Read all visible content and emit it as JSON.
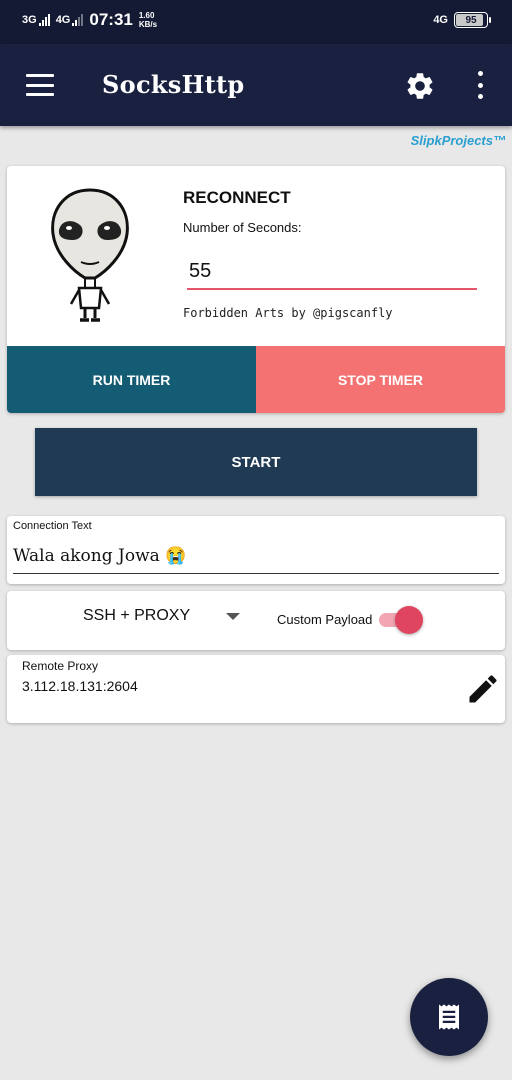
{
  "status_bar": {
    "network1": "3G",
    "network2": "4G",
    "time": "07:31",
    "speed_value": "1.60",
    "speed_unit": "KB/s",
    "network_right": "4G",
    "battery": "95"
  },
  "app_bar": {
    "title": "SocksHttp",
    "menu_icon": "hamburger-menu-icon",
    "settings_icon": "gear-icon",
    "overflow_icon": "more-vert-icon"
  },
  "brand": "SlipkProjects™",
  "timer": {
    "heading": "RECONNECT",
    "seconds_label": "Number of Seconds:",
    "seconds_value": "55",
    "credit": "Forbidden Arts by @pigscanfly",
    "run_label": "RUN TIMER",
    "stop_label": "STOP TIMER",
    "run_color": "#135c73",
    "stop_color": "#f47272"
  },
  "start_label": "START",
  "connection": {
    "label": "Connection Text",
    "value": "Wala akong Jowa 😭"
  },
  "proxy": {
    "mode_selected": "SSH + PROXY",
    "custom_payload_label": "Custom Payload",
    "custom_payload_enabled": true
  },
  "remote": {
    "label": "Remote Proxy",
    "value": "3.112.18.131:2604"
  },
  "fab_icon": "log-receipt-icon",
  "colors": {
    "app_bar": "#1a2140",
    "accent": "#e0455f",
    "start_button": "#1f3a52"
  }
}
